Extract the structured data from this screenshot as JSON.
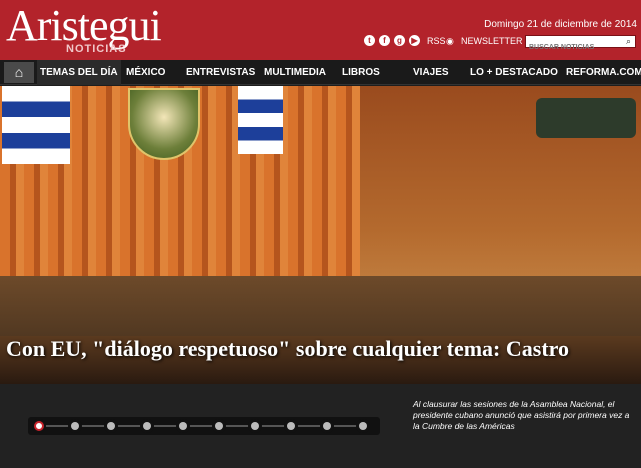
{
  "header": {
    "logo": "Aristegui",
    "logo_sub": "NOTICIAS",
    "date": "Domingo 21 de diciembre de 2014",
    "rss_label": "RSS",
    "newsletter_label": "NEWSLETTER",
    "search_placeholder": "BUSCAR NOTICIAS"
  },
  "nav": {
    "items": [
      {
        "label": "TEMAS DEL DÍA"
      },
      {
        "label": "MÉXICO"
      },
      {
        "label": "ENTREVISTAS"
      },
      {
        "label": "MULTIMEDIA"
      },
      {
        "label": "LIBROS"
      },
      {
        "label": "VIAJES"
      },
      {
        "label": "LO + DESTACADO"
      },
      {
        "label": "REFORMA.COM"
      }
    ]
  },
  "hero": {
    "headline": "Con EU, \"diálogo respetuoso\" sobre cualquier tema: Castro"
  },
  "slider": {
    "active_index": 0,
    "count": 10,
    "caption": "Al clausurar las sesiones de la Asamblea Nacional, el presidente cubano anunció que asistirá por primera vez a la Cumbre de las Américas"
  },
  "colors": {
    "brand_red": "#b3232b",
    "nav_bg": "#1a1a1a"
  }
}
